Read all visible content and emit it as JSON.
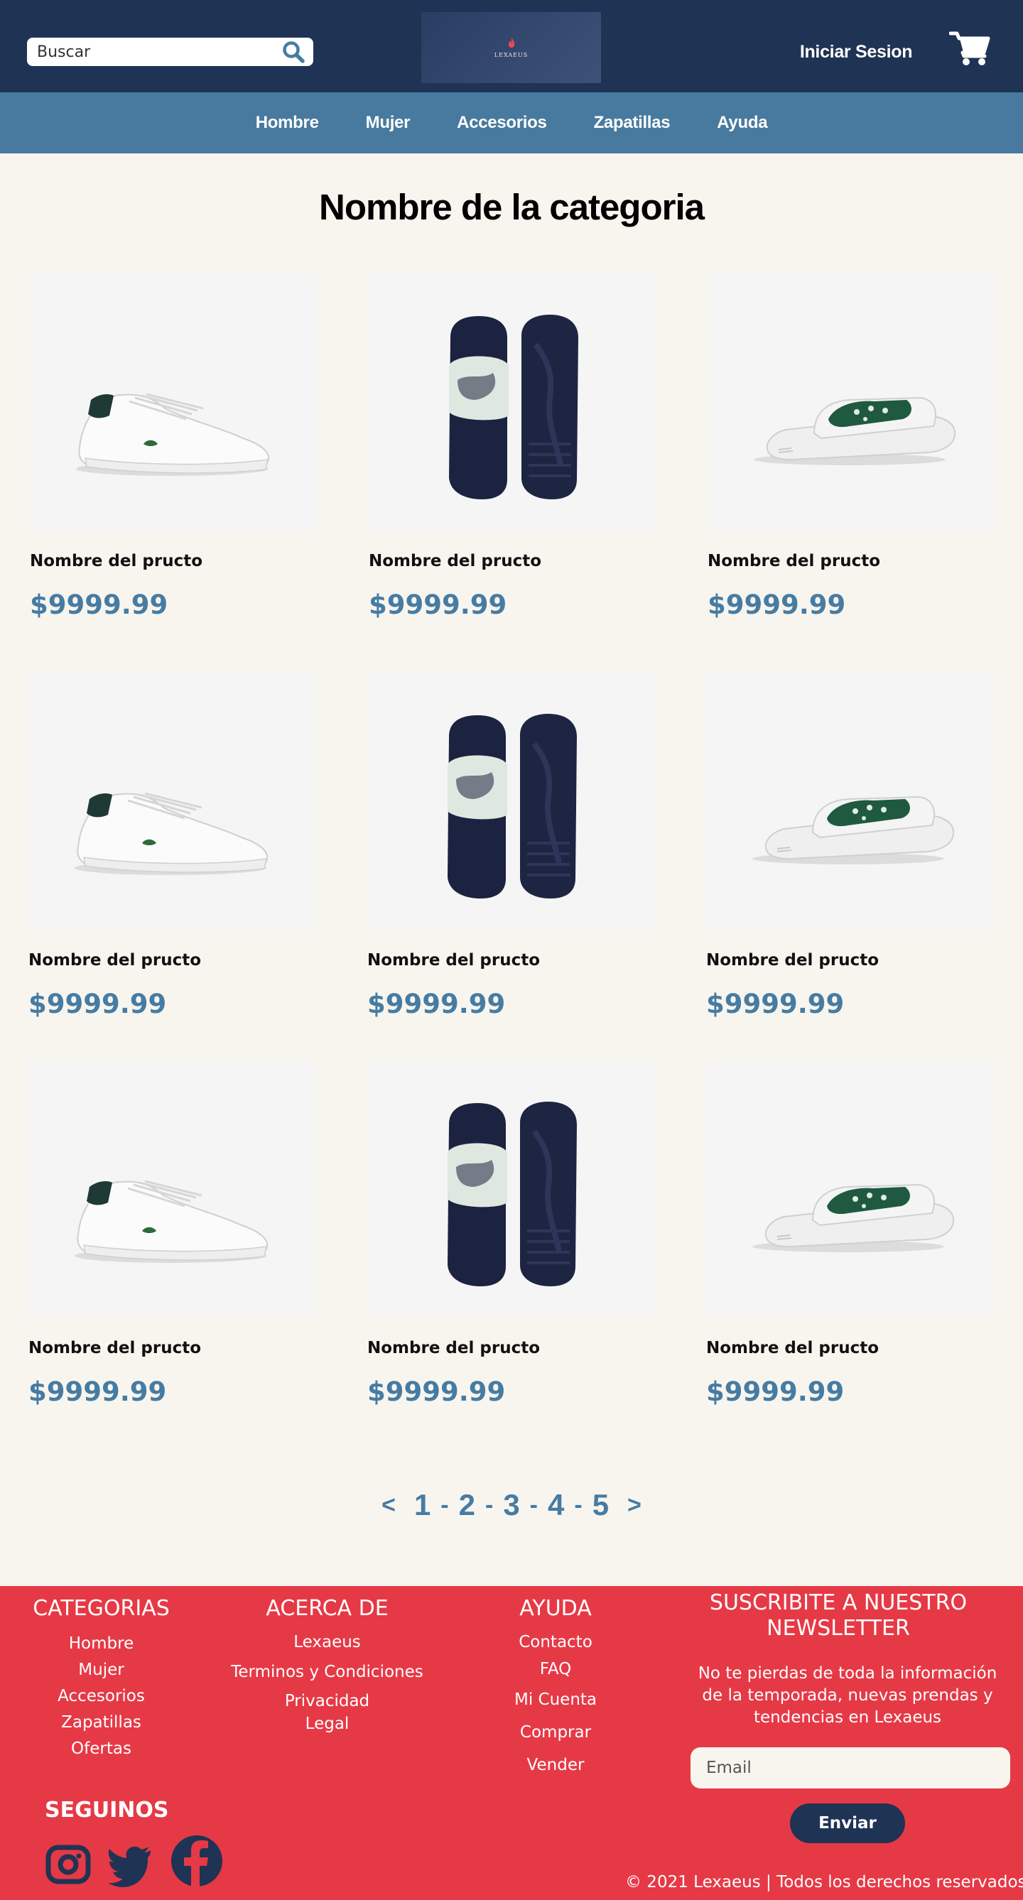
{
  "header": {
    "search_placeholder": "Buscar",
    "logo_text": "LEXAEUS",
    "login_label": "Iniciar Sesion"
  },
  "nav": {
    "items": [
      "Hombre",
      "Mujer",
      "Accesorios",
      "Zapatillas",
      "Ayuda"
    ]
  },
  "category": {
    "title": "Nombre de la categoria"
  },
  "products": [
    {
      "name": "Nombre del pructo",
      "price": "$9999.99",
      "image": "white-sneaker"
    },
    {
      "name": "Nombre del pructo",
      "price": "$9999.99",
      "image": "navy-slide-pair"
    },
    {
      "name": "Nombre del pructo",
      "price": "$9999.99",
      "image": "white-green-slide"
    },
    {
      "name": "Nombre del pructo",
      "price": "$9999.99",
      "image": "white-sneaker"
    },
    {
      "name": "Nombre del pructo",
      "price": "$9999.99",
      "image": "navy-slide-pair"
    },
    {
      "name": "Nombre del pructo",
      "price": "$9999.99",
      "image": "white-green-slide"
    },
    {
      "name": "Nombre del pructo",
      "price": "$9999.99",
      "image": "white-sneaker"
    },
    {
      "name": "Nombre del pructo",
      "price": "$9999.99",
      "image": "navy-slide-pair"
    },
    {
      "name": "Nombre del pructo",
      "price": "$9999.99",
      "image": "white-green-slide"
    }
  ],
  "pagination": {
    "prev": "<",
    "next": ">",
    "pages": [
      "1",
      "2",
      "3",
      "4",
      "5"
    ],
    "separator": "-"
  },
  "footer": {
    "categorias": {
      "heading": "CATEGORIAS",
      "links": [
        "Hombre",
        "Mujer",
        "Accesorios",
        "Zapatillas",
        "Ofertas"
      ]
    },
    "acerca": {
      "heading": "ACERCA DE",
      "links": [
        "Lexaeus",
        "Terminos y Condiciones",
        "Privacidad",
        "Legal"
      ]
    },
    "ayuda": {
      "heading": "AYUDA",
      "links": [
        "Contacto",
        "FAQ",
        "Mi Cuenta",
        "Comprar",
        "Vender"
      ]
    },
    "newsletter": {
      "heading_line1": "SUSCRIBITE A NUESTRO",
      "heading_line2": "NEWSLETTER",
      "text": "No te pierdas de toda la información de la temporada, nuevas prendas y tendencias en Lexaeus",
      "email_placeholder": "Email",
      "button": "Enviar"
    },
    "social": {
      "heading": "SEGUINOS",
      "icons": [
        "instagram-icon",
        "twitter-icon",
        "facebook-icon"
      ]
    },
    "copyright": "© 2021 Lexaeus | Todos los derechos reservados"
  },
  "colors": {
    "header_bg": "#1f3354",
    "nav_bg": "#487a9f",
    "page_bg": "#f8f5ef",
    "price": "#467ca3",
    "footer_bg": "#e63946"
  }
}
